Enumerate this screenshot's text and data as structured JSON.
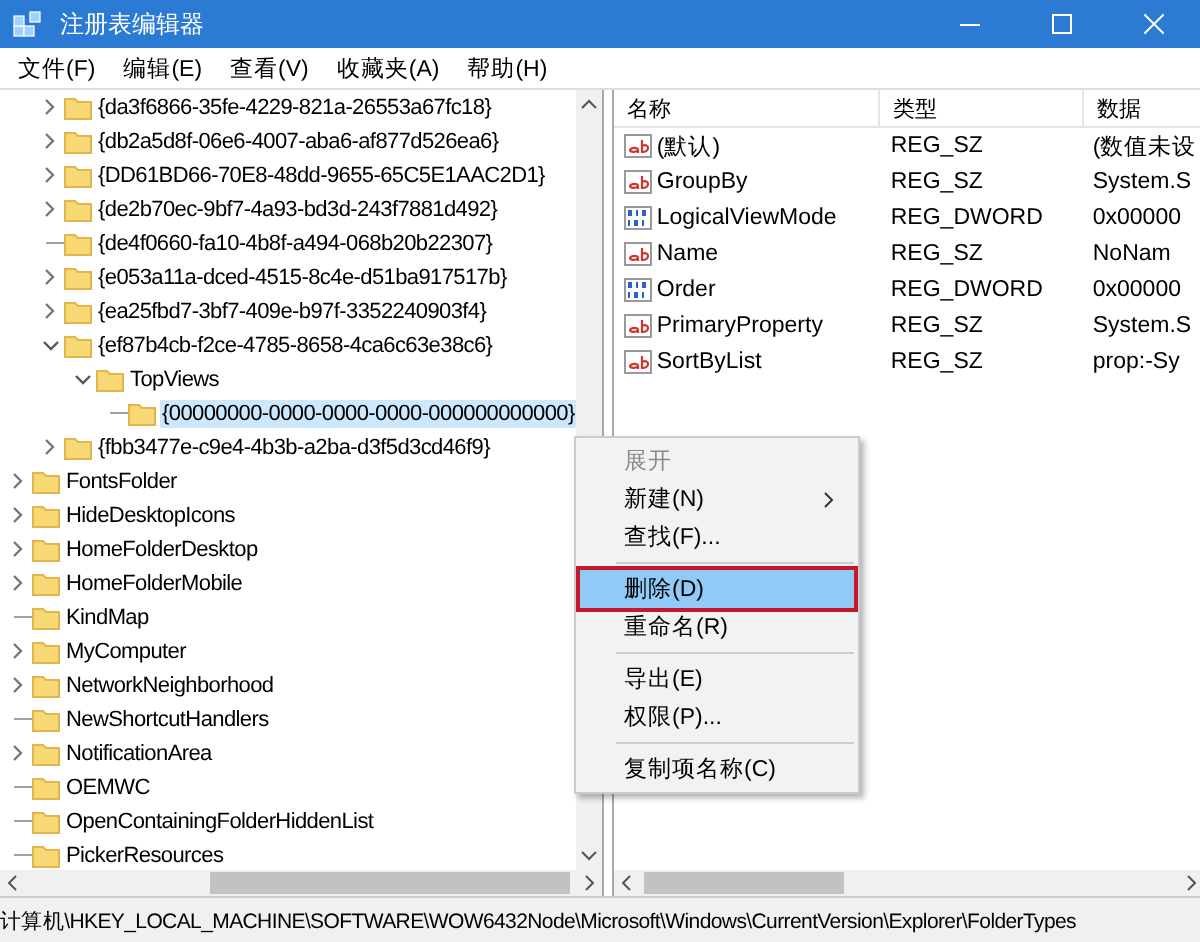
{
  "window": {
    "title": "注册表编辑器"
  },
  "menu": [
    "文件(F)",
    "编辑(E)",
    "查看(V)",
    "收藏夹(A)",
    "帮助(H)"
  ],
  "tree": {
    "items": [
      {
        "children": [
          {
            "label": "{da3f6866-35fe-4229-821a-26553a67fc18}",
            "kind": "collapsed",
            "selected": false
          },
          {
            "label": "{db2a5d8f-06e6-4007-aba6-af877d526ea6}",
            "kind": "collapsed",
            "selected": false
          },
          {
            "label": "{DD61BD66-70E8-48dd-9655-65C5E1AAC2D1}",
            "kind": "collapsed",
            "selected": false
          },
          {
            "label": "{de2b70ec-9bf7-4a93-bd3d-243f7881d492}",
            "kind": "collapsed",
            "selected": false
          },
          {
            "label": "{de4f0660-fa10-4b8f-a494-068b20b22307}",
            "kind": "leaf",
            "selected": false
          },
          {
            "label": "{e053a11a-dced-4515-8c4e-d51ba917517b}",
            "kind": "collapsed",
            "selected": false
          },
          {
            "label": "{ea25fbd7-3bf7-409e-b97f-3352240903f4}",
            "kind": "collapsed",
            "selected": false
          },
          {
            "label": "{ef87b4cb-f2ce-4785-8658-4ca6c63e38c6}",
            "kind": "expanded",
            "selected": false,
            "children": [
              {
                "label": "TopViews",
                "kind": "expanded",
                "selected": false,
                "children": [
                  {
                    "label": "{00000000-0000-0000-0000-000000000000}",
                    "kind": "leaf",
                    "selected": true
                  }
                ]
              }
            ]
          },
          {
            "label": "{fbb3477e-c9e4-4b3b-a2ba-d3f5d3cd46f9}",
            "kind": "collapsed",
            "selected": false
          }
        ]
      },
      {
        "label": "FontsFolder",
        "kind": "collapsed",
        "selected": false
      },
      {
        "label": "HideDesktopIcons",
        "kind": "collapsed",
        "selected": false
      },
      {
        "label": "HomeFolderDesktop",
        "kind": "collapsed",
        "selected": false
      },
      {
        "label": "HomeFolderMobile",
        "kind": "collapsed",
        "selected": false
      },
      {
        "label": "KindMap",
        "kind": "leaf",
        "selected": false
      },
      {
        "label": "MyComputer",
        "kind": "collapsed",
        "selected": false
      },
      {
        "label": "NetworkNeighborhood",
        "kind": "collapsed",
        "selected": false
      },
      {
        "label": "NewShortcutHandlers",
        "kind": "leaf",
        "selected": false
      },
      {
        "label": "NotificationArea",
        "kind": "collapsed",
        "selected": false
      },
      {
        "label": "OEMWC",
        "kind": "leaf",
        "selected": false
      },
      {
        "label": "OpenContainingFolderHiddenList",
        "kind": "leaf",
        "selected": false
      },
      {
        "label": "PickerResources",
        "kind": "leaf",
        "selected": false
      }
    ]
  },
  "values": {
    "columns": [
      "名称",
      "类型",
      "数据"
    ],
    "rows": [
      {
        "kind": "string",
        "name": "(默认)",
        "type": "REG_SZ",
        "data": "(数值未设"
      },
      {
        "kind": "string",
        "name": "GroupBy",
        "type": "REG_SZ",
        "data": "System.S"
      },
      {
        "kind": "binary",
        "name": "LogicalViewMode",
        "type": "REG_DWORD",
        "data": "0x00000"
      },
      {
        "kind": "string",
        "name": "Name",
        "type": "REG_SZ",
        "data": "NoNam"
      },
      {
        "kind": "binary",
        "name": "Order",
        "type": "REG_DWORD",
        "data": "0x00000"
      },
      {
        "kind": "string",
        "name": "PrimaryProperty",
        "type": "REG_SZ",
        "data": "System.S"
      },
      {
        "kind": "string",
        "name": "SortByList",
        "type": "REG_SZ",
        "data": "prop:-Sy"
      }
    ]
  },
  "context_menu": [
    {
      "kind": "item",
      "label": "展开",
      "disabled": true,
      "selected": false,
      "submenu": false
    },
    {
      "kind": "item",
      "label": "新建(N)",
      "disabled": false,
      "selected": false,
      "submenu": true
    },
    {
      "kind": "item",
      "label": "查找(F)...",
      "disabled": false,
      "selected": false,
      "submenu": false
    },
    {
      "kind": "separator"
    },
    {
      "kind": "item",
      "label": "删除(D)",
      "disabled": false,
      "selected": true,
      "submenu": false
    },
    {
      "kind": "item",
      "label": "重命名(R)",
      "disabled": false,
      "selected": false,
      "submenu": false
    },
    {
      "kind": "separator"
    },
    {
      "kind": "item",
      "label": "导出(E)",
      "disabled": false,
      "selected": false,
      "submenu": false
    },
    {
      "kind": "item",
      "label": "权限(P)...",
      "disabled": false,
      "selected": false,
      "submenu": false
    },
    {
      "kind": "separator"
    },
    {
      "kind": "item",
      "label": "复制项名称(C)",
      "disabled": false,
      "selected": false,
      "submenu": false
    }
  ],
  "status_bar": "计算机\\HKEY_LOCAL_MACHINE\\SOFTWARE\\WOW6432Node\\Microsoft\\Windows\\CurrentVersion\\Explorer\\FolderTypes"
}
